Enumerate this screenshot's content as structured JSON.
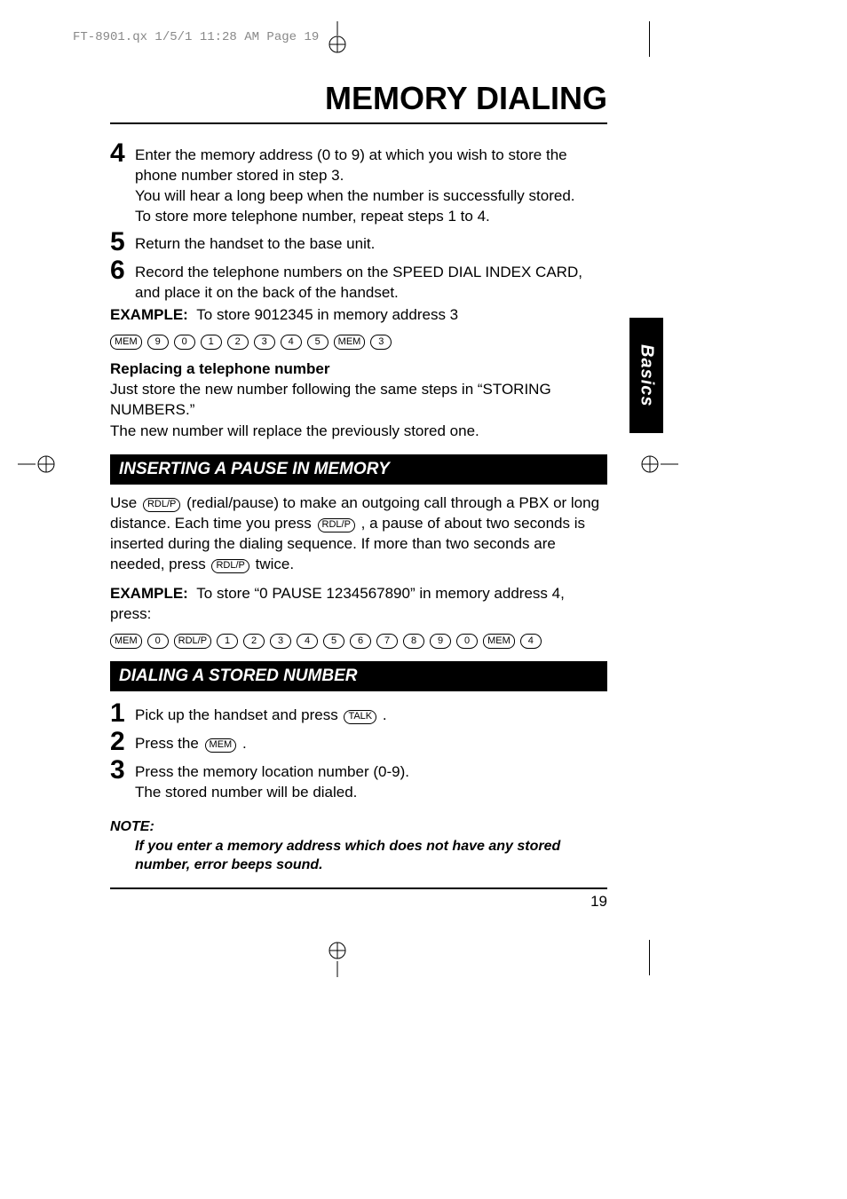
{
  "header_meta": "FT-8901.qx  1/5/1 11:28 AM  Page 19",
  "title": "MEMORY DIALING",
  "side_tab": "Basics",
  "steps_top": [
    {
      "num": "4",
      "body_pre": "Enter the memory address (0 to 9) at which you wish to store the phone number stored in step 3.",
      "body_post1": "You will hear a long beep when the number is successfully stored.",
      "body_post2": "To store more telephone number, repeat steps 1 to 4."
    },
    {
      "num": "5",
      "body_pre": "Return the handset to the base unit."
    },
    {
      "num": "6",
      "body_pre": "Record the telephone numbers on the SPEED DIAL INDEX CARD, and place it on the back of the handset."
    }
  ],
  "example1": {
    "label": "EXAMPLE:",
    "text": "To store 9012345 in memory address 3",
    "keys": [
      "MEM",
      "9",
      "0",
      "1",
      "2",
      "3",
      "4",
      "5",
      "MEM",
      "3"
    ]
  },
  "replacing": {
    "heading": "Replacing a telephone number",
    "line1": "Just store the new number following the same steps in “STORING NUMBERS.”",
    "line2": "The new number will replace the previously stored one."
  },
  "section1": "INSERTING A PAUSE IN MEMORY",
  "pause_para": {
    "pre": "Use ",
    "k1": "RDL/P",
    "mid1": " (redial/pause) to make an outgoing call through a PBX or long distance. Each time you press ",
    "k2": "RDL/P",
    "mid2": " , a pause of about two seconds is inserted during the dialing sequence. If more than two seconds are needed, press ",
    "k3": "RDL/P",
    "post": " twice."
  },
  "example2": {
    "label": "EXAMPLE:",
    "text": "To store “0 PAUSE 1234567890” in memory address 4, press:",
    "keys": [
      "MEM",
      "0",
      "RDL/P",
      "1",
      "2",
      "3",
      "4",
      "5",
      "6",
      "7",
      "8",
      "9",
      "0",
      "MEM",
      "4"
    ]
  },
  "section2": "DIALING A STORED NUMBER",
  "steps_bottom": [
    {
      "num": "1",
      "pre": "Pick up the handset and press ",
      "key": "TALK",
      "post": " ."
    },
    {
      "num": "2",
      "pre": "Press the ",
      "key": "MEM",
      "post": " ."
    },
    {
      "num": "3",
      "pre": "Press the memory location number (0-9).",
      "line2": "The stored number will be dialed."
    }
  ],
  "note": {
    "label": "NOTE:",
    "body": "If you enter a memory address which does not have any stored number, error beeps sound."
  },
  "page_number": "19"
}
